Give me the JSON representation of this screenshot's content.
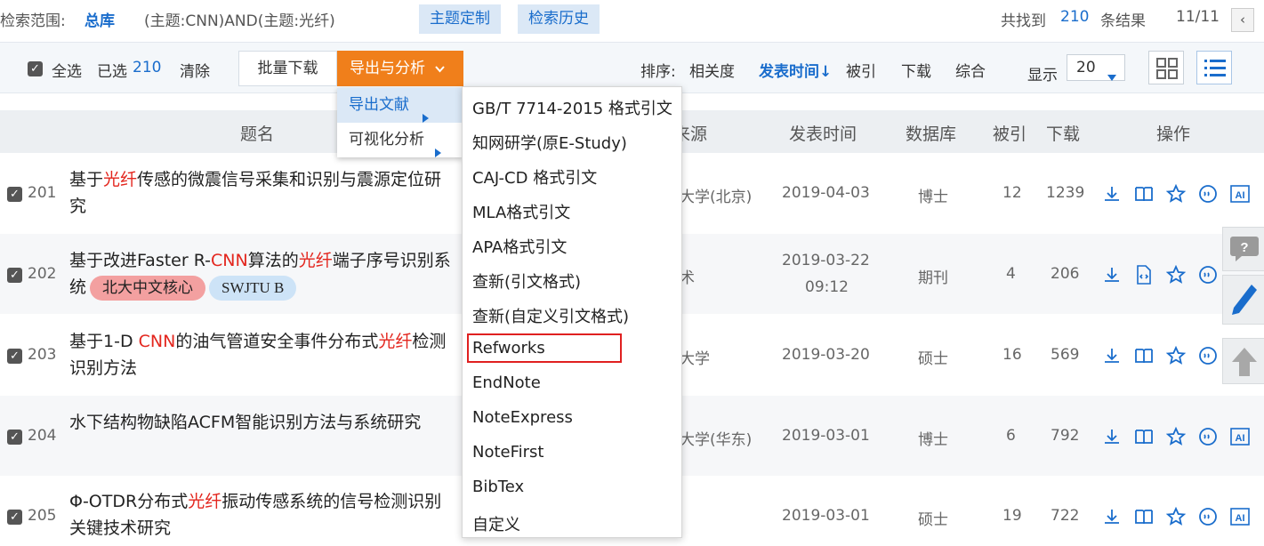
{
  "search": {
    "scope_label": "检索范围:",
    "scope_value": "总库",
    "query": "(主题:CNN)AND(主题:光纤)",
    "custom_btn": "主题定制",
    "history_btn": "检索历史",
    "found_prefix": "共找到",
    "found_count": "210",
    "found_suffix": "条结果",
    "page": "11/11",
    "prev_arrow": "‹"
  },
  "toolbar": {
    "select_all": "全选",
    "selected_label": "已选",
    "selected_count": "210",
    "clear": "清除",
    "batch_download": "批量下载",
    "export_analysis": "导出与分析",
    "sort_label": "排序:",
    "sort_relevance": "相关度",
    "sort_date": "发表时间",
    "sort_cited": "被引",
    "sort_download": "下载",
    "sort_composite": "综合",
    "show_label": "显示",
    "page_size": "20"
  },
  "table": {
    "headers": {
      "title": "题名",
      "source": "来源",
      "date": "发表时间",
      "db": "数据库",
      "cited": "被引",
      "download": "下载",
      "ops": "操作"
    },
    "rows": [
      {
        "num": "201",
        "title_parts": [
          "基于",
          "光纤",
          "传感的微震信号采集和识别与震源定位研究"
        ],
        "source": "大学(北京)",
        "date": "2019-04-03",
        "time": "",
        "db": "博士",
        "cited": "12",
        "downloads": "1239"
      },
      {
        "num": "202",
        "title_parts": [
          "基于改进Faster R-",
          "CNN",
          "算法的",
          "光纤",
          "端子序号识别系统"
        ],
        "badges": [
          "北大中文核心",
          "SWJTU B"
        ],
        "source": "术",
        "date": "2019-03-22",
        "time": "09:12",
        "db": "期刊",
        "cited": "4",
        "downloads": "206"
      },
      {
        "num": "203",
        "title_parts": [
          "基于1-D ",
          "CNN",
          "的油气管道安全事件分布式",
          "光纤",
          "检测识别方法"
        ],
        "source": "大学",
        "date": "2019-03-20",
        "time": "",
        "db": "硕士",
        "cited": "16",
        "downloads": "569"
      },
      {
        "num": "204",
        "title_parts": [
          "水下结构物缺陷ACFM智能识别方法与系统研究"
        ],
        "source": "大学(华东)",
        "date": "2019-03-01",
        "time": "",
        "db": "博士",
        "cited": "6",
        "downloads": "792"
      },
      {
        "num": "205",
        "title_parts": [
          "Φ-OTDR分布式",
          "光纤",
          "振动传感系统的信号检测识别关键技术研究"
        ],
        "source": "",
        "date": "2019-03-01",
        "time": "",
        "db": "硕士",
        "cited": "19",
        "downloads": "722"
      }
    ]
  },
  "submenu": {
    "export_docs": "导出文献",
    "visual_analysis": "可视化分析"
  },
  "export_menu": [
    "GB/T 7714-2015 格式引文",
    "知网研学(原E-Study)",
    "CAJ-CD 格式引文",
    "MLA格式引文",
    "APA格式引文",
    "查新(引文格式)",
    "查新(自定义引文格式)",
    "Refworks",
    "EndNote",
    "NoteExpress",
    "NoteFirst",
    "BibTex",
    "自定义"
  ],
  "colors": {
    "accent": "#1a6dcc",
    "export_orange": "#f07f1b",
    "highlight_red": "#e3261e",
    "focus_border": "#e02020"
  }
}
